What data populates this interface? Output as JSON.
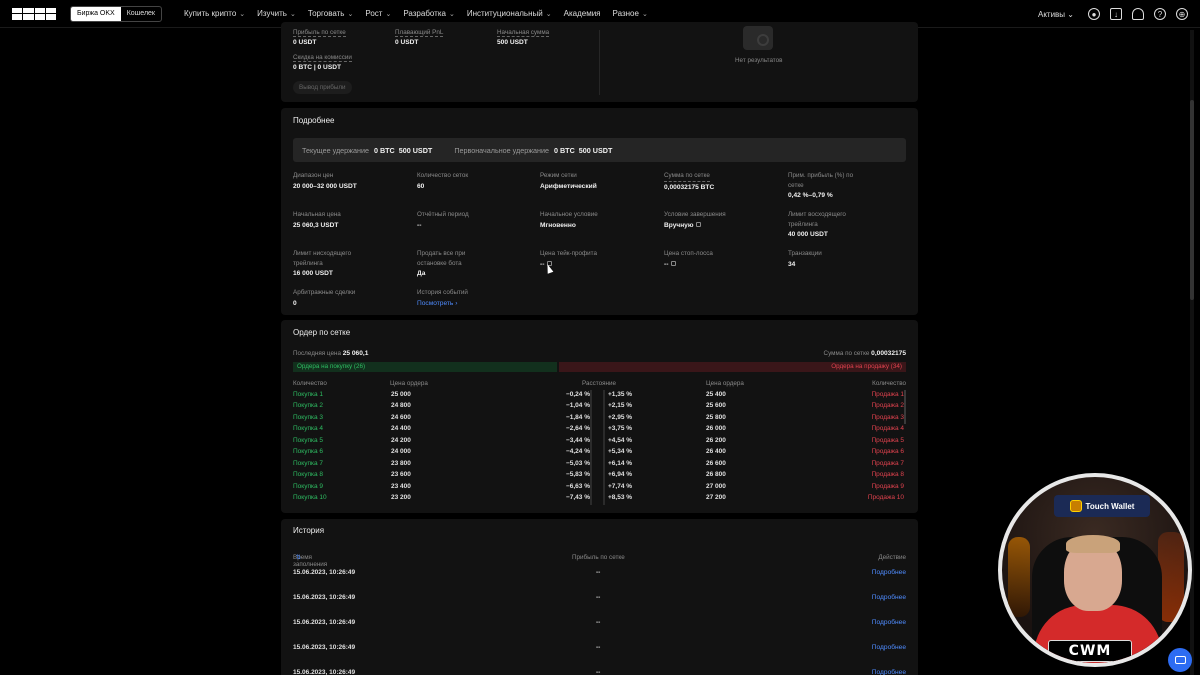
{
  "nav": {
    "switch": [
      "Биржа OKX",
      "Кошелек"
    ],
    "menu": [
      "Купить крипто",
      "Изучить",
      "Торговать",
      "Рост",
      "Разработка",
      "Институциональный",
      "Академия",
      "Разное"
    ],
    "assets": "Активы"
  },
  "summary": {
    "profit_label": "Прибыль по сетке",
    "profit_value": "0 USDT",
    "floating_label": "Плавающий PnL",
    "floating_value": "0 USDT",
    "initial_label": "Начальная сумма",
    "initial_value": "500 USDT",
    "discount_label": "Скидка на комиссии",
    "discount_value": "0 BTC | 0 USDT",
    "withdraw_button": "Вывод прибыли",
    "no_results": "Нет результатов"
  },
  "details": {
    "title": "Подробнее",
    "current_hold_label": "Текущее удержание",
    "current_hold_btc": "0 BTC",
    "current_hold_usdt": "500 USDT",
    "initial_hold_label": "Первоначальное удержание",
    "initial_hold_btc": "0 BTC",
    "initial_hold_usdt": "500 USDT",
    "cells": [
      {
        "label": "Диапазон цен",
        "value": "20 000–32 000 USDT"
      },
      {
        "label": "Количество сеток",
        "value": "60"
      },
      {
        "label": "Режим сетки",
        "value": "Арифметический"
      },
      {
        "label": "Сумма по сетке",
        "value": "0,00032175 BTC"
      },
      {
        "label": "Прим. прибыль (%) по сетке",
        "value": "0,42 %–0,79 %"
      },
      {
        "label": "Начальная цена",
        "value": "25 060,3 USDT"
      },
      {
        "label": "Отчётный период",
        "value": "--"
      },
      {
        "label": "Начальное условие",
        "value": "Мгновенно"
      },
      {
        "label": "Условие завершения",
        "value": "Вручную"
      },
      {
        "label": "Лимит восходящего трейлинга",
        "value": "40 000 USDT"
      },
      {
        "label": "Лимит нисходящего трейлинга",
        "value": "16 000 USDT"
      },
      {
        "label": "Продать все при остановке бота",
        "value": "Да"
      },
      {
        "label": "Цена тейк-профита",
        "value": "--"
      },
      {
        "label": "Цена стоп-лосса",
        "value": "--"
      },
      {
        "label": "Транзакции",
        "value": "34"
      },
      {
        "label": "Арбитражные сделки",
        "value": "0"
      },
      {
        "label": "История событий",
        "value": "Посмотреть"
      }
    ]
  },
  "orders": {
    "title": "Ордер по сетке",
    "last_price_label": "Последняя цена",
    "last_price_value": "25 060,1",
    "grid_sum_label": "Сумма по сетке",
    "grid_sum_value": "0,00032175",
    "buy_bar": "Ордера на покупку (26)",
    "sell_bar": "Ордера на продажу (34)",
    "headers": [
      "Количество",
      "Цена ордера",
      "Расстояние",
      "Цена ордера",
      "Количество"
    ],
    "rows": [
      {
        "buy": "Покупка 1",
        "buy_price": "25 000",
        "buy_dist": "−0,24 %",
        "sell_dist": "+1,35 %",
        "sell_price": "25 400",
        "sell": "Продажа 1"
      },
      {
        "buy": "Покупка 2",
        "buy_price": "24 800",
        "buy_dist": "−1,04 %",
        "sell_dist": "+2,15 %",
        "sell_price": "25 600",
        "sell": "Продажа 2"
      },
      {
        "buy": "Покупка 3",
        "buy_price": "24 600",
        "buy_dist": "−1,84 %",
        "sell_dist": "+2,95 %",
        "sell_price": "25 800",
        "sell": "Продажа 3"
      },
      {
        "buy": "Покупка 4",
        "buy_price": "24 400",
        "buy_dist": "−2,64 %",
        "sell_dist": "+3,75 %",
        "sell_price": "26 000",
        "sell": "Продажа 4"
      },
      {
        "buy": "Покупка 5",
        "buy_price": "24 200",
        "buy_dist": "−3,44 %",
        "sell_dist": "+4,54 %",
        "sell_price": "26 200",
        "sell": "Продажа 5"
      },
      {
        "buy": "Покупка 6",
        "buy_price": "24 000",
        "buy_dist": "−4,24 %",
        "sell_dist": "+5,34 %",
        "sell_price": "26 400",
        "sell": "Продажа 6"
      },
      {
        "buy": "Покупка 7",
        "buy_price": "23 800",
        "buy_dist": "−5,03 %",
        "sell_dist": "+6,14 %",
        "sell_price": "26 600",
        "sell": "Продажа 7"
      },
      {
        "buy": "Покупка 8",
        "buy_price": "23 600",
        "buy_dist": "−5,83 %",
        "sell_dist": "+6,94 %",
        "sell_price": "26 800",
        "sell": "Продажа 8"
      },
      {
        "buy": "Покупка 9",
        "buy_price": "23 400",
        "buy_dist": "−6,63 %",
        "sell_dist": "+7,74 %",
        "sell_price": "27 000",
        "sell": "Продажа 9"
      },
      {
        "buy": "Покупка 10",
        "buy_price": "23 200",
        "buy_dist": "−7,43 %",
        "sell_dist": "+8,53 %",
        "sell_price": "27 200",
        "sell": "Продажа 10"
      }
    ]
  },
  "history": {
    "title": "История",
    "col_time": "Время заполнения",
    "col_profit": "Прибыль по сетке",
    "col_action": "Действие",
    "rows": [
      {
        "time": "15.06.2023, 10:26:49",
        "profit": "--",
        "action": "Подробнее"
      },
      {
        "time": "15.06.2023, 10:26:49",
        "profit": "--",
        "action": "Подробнее"
      },
      {
        "time": "15.06.2023, 10:26:49",
        "profit": "--",
        "action": "Подробнее"
      },
      {
        "time": "15.06.2023, 10:26:49",
        "profit": "--",
        "action": "Подробнее"
      },
      {
        "time": "15.06.2023, 10:26:49",
        "profit": "--",
        "action": "Подробнее"
      }
    ]
  },
  "webcam": {
    "sign": "Touch Wallet",
    "logo": "CWM"
  }
}
